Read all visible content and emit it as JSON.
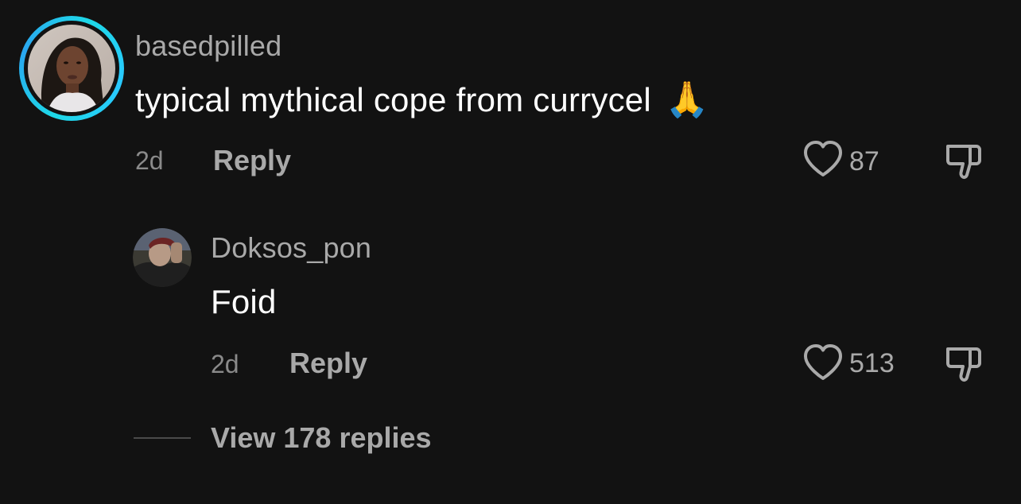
{
  "comment": {
    "username": "basedpilled",
    "text": "typical mythical cope from currycel",
    "emoji": "🙏",
    "time": "2d",
    "reply_label": "Reply",
    "likes": "87",
    "avatar_icon": "user-avatar-photo"
  },
  "reply": {
    "username": "Doksos_pon",
    "text": "Foid",
    "time": "2d",
    "reply_label": "Reply",
    "likes": "513",
    "avatar_icon": "user-avatar-photo"
  },
  "view_replies": {
    "label": "View 178 replies"
  },
  "icons": {
    "like": "heart-icon",
    "dislike": "thumbs-down-icon"
  },
  "colors": {
    "background": "#121212",
    "story_ring": "#1ed8e8",
    "muted_text": "#a9a9a9"
  }
}
